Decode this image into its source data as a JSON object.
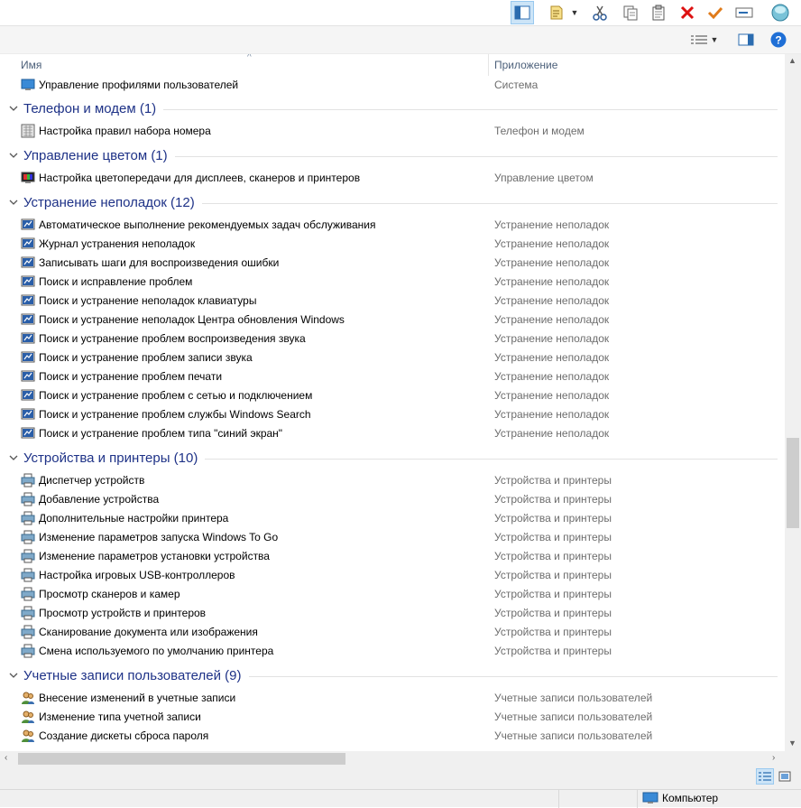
{
  "columns": {
    "name": "Имя",
    "app": "Приложение"
  },
  "top_row": {
    "name": "Управление профилями пользователей",
    "app": "Система",
    "icon": "user-profiles-icon"
  },
  "groups": [
    {
      "title": "Телефон и модем (1)",
      "items": [
        {
          "name": "Настройка правил набора номера",
          "app": "Телефон и модем",
          "icon": "phone-modem-icon"
        }
      ]
    },
    {
      "title": "Управление цветом (1)",
      "items": [
        {
          "name": "Настройка цветопередачи для дисплеев, сканеров и принтеров",
          "app": "Управление цветом",
          "icon": "color-management-icon"
        }
      ]
    },
    {
      "title": "Устранение неполадок (12)",
      "items": [
        {
          "name": "Автоматическое выполнение рекомендуемых задач обслуживания",
          "app": "Устранение неполадок",
          "icon": "troubleshoot-icon"
        },
        {
          "name": "Журнал устранения неполадок",
          "app": "Устранение неполадок",
          "icon": "troubleshoot-icon"
        },
        {
          "name": "Записывать шаги для воспроизведения ошибки",
          "app": "Устранение неполадок",
          "icon": "troubleshoot-icon"
        },
        {
          "name": "Поиск и исправление проблем",
          "app": "Устранение неполадок",
          "icon": "troubleshoot-icon"
        },
        {
          "name": "Поиск и устранение неполадок клавиатуры",
          "app": "Устранение неполадок",
          "icon": "troubleshoot-icon"
        },
        {
          "name": "Поиск и устранение неполадок Центра обновления Windows",
          "app": "Устранение неполадок",
          "icon": "troubleshoot-icon"
        },
        {
          "name": "Поиск и устранение проблем воспроизведения звука",
          "app": "Устранение неполадок",
          "icon": "troubleshoot-icon"
        },
        {
          "name": "Поиск и устранение проблем записи звука",
          "app": "Устранение неполадок",
          "icon": "troubleshoot-icon"
        },
        {
          "name": "Поиск и устранение проблем печати",
          "app": "Устранение неполадок",
          "icon": "troubleshoot-icon"
        },
        {
          "name": "Поиск и устранение проблем с сетью и подключением",
          "app": "Устранение неполадок",
          "icon": "troubleshoot-icon"
        },
        {
          "name": "Поиск и устранение проблем службы Windows Search",
          "app": "Устранение неполадок",
          "icon": "troubleshoot-icon"
        },
        {
          "name": "Поиск и устранение проблем типа \"синий экран\"",
          "app": "Устранение неполадок",
          "icon": "troubleshoot-icon"
        }
      ]
    },
    {
      "title": "Устройства и принтеры (10)",
      "items": [
        {
          "name": "Диспетчер устройств",
          "app": "Устройства и принтеры",
          "icon": "devices-printers-icon"
        },
        {
          "name": "Добавление устройства",
          "app": "Устройства и принтеры",
          "icon": "devices-printers-icon"
        },
        {
          "name": "Дополнительные настройки принтера",
          "app": "Устройства и принтеры",
          "icon": "devices-printers-icon"
        },
        {
          "name": "Изменение параметров запуска Windows To Go",
          "app": "Устройства и принтеры",
          "icon": "devices-printers-icon"
        },
        {
          "name": "Изменение параметров установки устройства",
          "app": "Устройства и принтеры",
          "icon": "devices-printers-icon"
        },
        {
          "name": "Настройка игровых USB-контроллеров",
          "app": "Устройства и принтеры",
          "icon": "devices-printers-icon"
        },
        {
          "name": "Просмотр сканеров и камер",
          "app": "Устройства и принтеры",
          "icon": "devices-printers-icon"
        },
        {
          "name": "Просмотр устройств и принтеров",
          "app": "Устройства и принтеры",
          "icon": "devices-printers-icon"
        },
        {
          "name": "Сканирование документа или изображения",
          "app": "Устройства и принтеры",
          "icon": "devices-printers-icon"
        },
        {
          "name": "Смена используемого по умолчанию принтера",
          "app": "Устройства и принтеры",
          "icon": "devices-printers-icon"
        }
      ]
    },
    {
      "title": "Учетные записи пользователей (9)",
      "items": [
        {
          "name": "Внесение изменений в учетные записи",
          "app": "Учетные записи пользователей",
          "icon": "user-accounts-icon"
        },
        {
          "name": "Изменение типа учетной записи",
          "app": "Учетные записи пользователей",
          "icon": "user-accounts-icon"
        },
        {
          "name": "Создание дискеты сброса пароля",
          "app": "Учетные записи пользователей",
          "icon": "user-accounts-icon"
        }
      ]
    }
  ],
  "statusbar": {
    "location": "Компьютер"
  }
}
